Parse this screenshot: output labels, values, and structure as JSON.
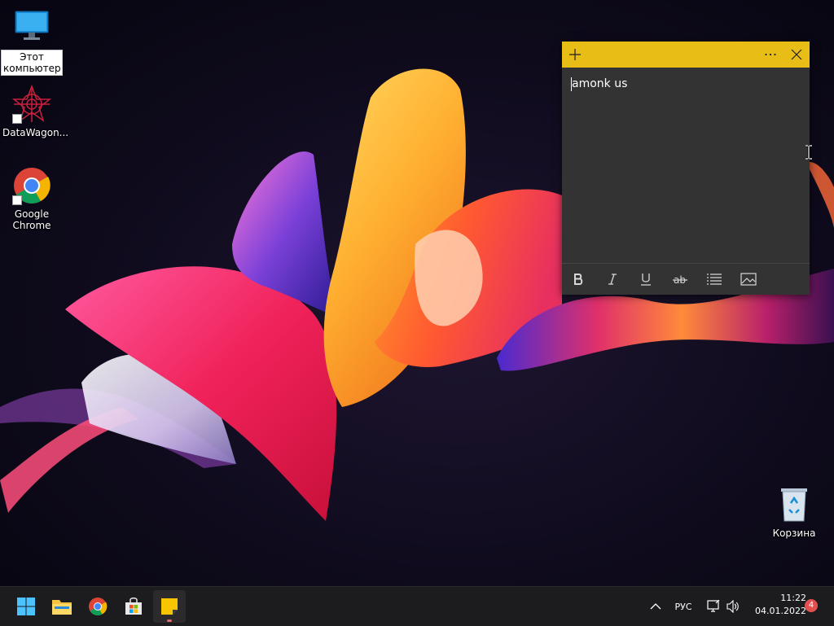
{
  "desktop": {
    "icons": [
      {
        "label": "Этот компьютер",
        "icon": "monitor-icon"
      },
      {
        "label": "DataWagon...",
        "icon": "datawagon-logo-icon"
      },
      {
        "label": "Google Chrome",
        "icon": "chrome-icon"
      },
      {
        "label": "Корзина",
        "icon": "recycle-bin-icon"
      }
    ]
  },
  "sticky_note": {
    "content": "amonk us",
    "titlebar_color": "#e8bd16",
    "body_color": "#333333",
    "toolbar": [
      "bold-icon",
      "italic-icon",
      "underline-icon",
      "strikethrough-icon",
      "bullet-list-icon",
      "image-icon"
    ]
  },
  "taskbar": {
    "apps": [
      "start-icon",
      "file-explorer-icon",
      "chrome-icon",
      "microsoft-store-icon",
      "sticky-notes-icon"
    ],
    "language": "РУС",
    "time": "11:22",
    "date": "04.01.2022",
    "notifications": "4"
  }
}
